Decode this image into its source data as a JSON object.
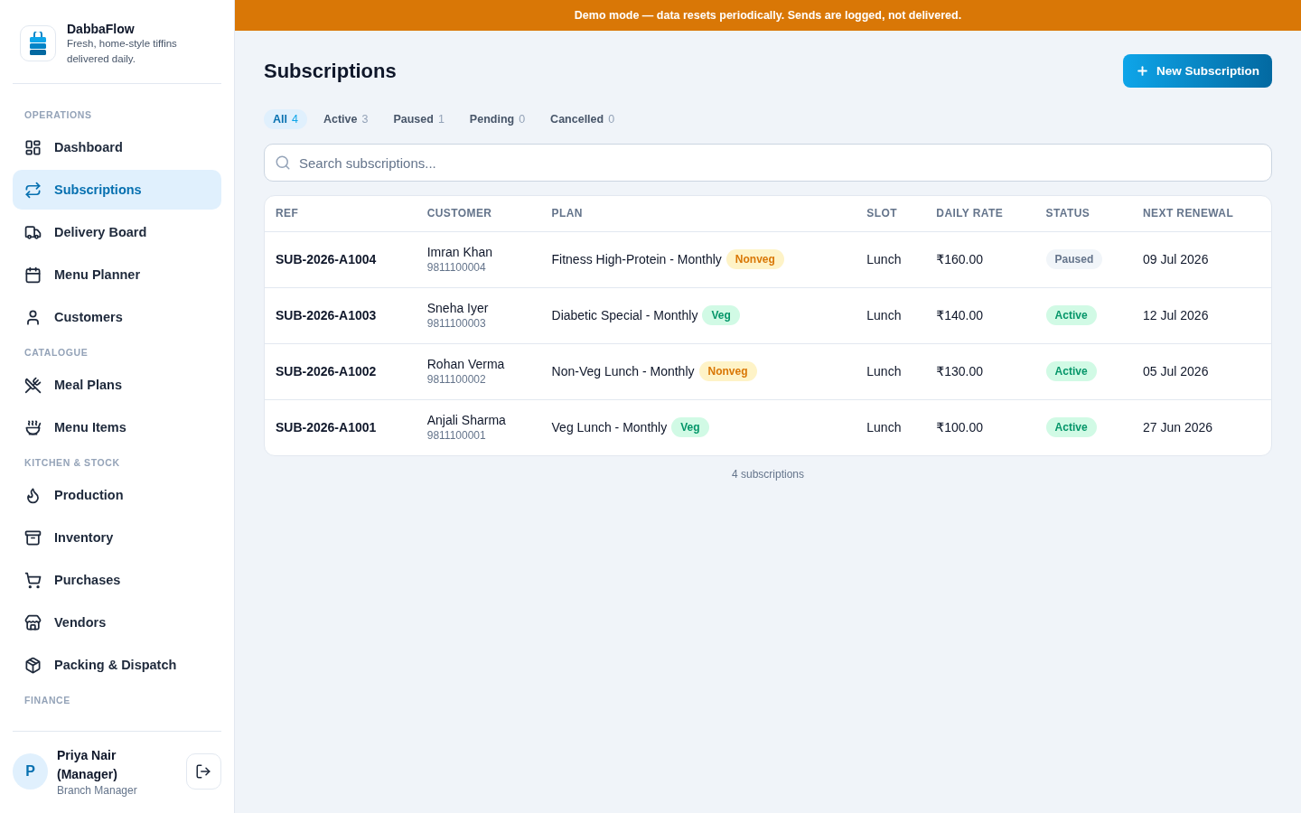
{
  "banner": "Demo mode — data resets periodically. Sends are logged, not delivered.",
  "brand": {
    "name": "DabbaFlow",
    "tagline": "Fresh, home-style tiffins delivered daily."
  },
  "sidebar": {
    "sections": [
      {
        "title": "OPERATIONS",
        "items": [
          {
            "label": "Dashboard",
            "selected": false
          },
          {
            "label": "Subscriptions",
            "selected": true
          },
          {
            "label": "Delivery Board",
            "selected": false
          },
          {
            "label": "Menu Planner",
            "selected": false
          },
          {
            "label": "Customers",
            "selected": false
          }
        ]
      },
      {
        "title": "CATALOGUE",
        "items": [
          {
            "label": "Meal Plans",
            "selected": false
          },
          {
            "label": "Menu Items",
            "selected": false
          }
        ]
      },
      {
        "title": "KITCHEN & STOCK",
        "items": [
          {
            "label": "Production",
            "selected": false
          },
          {
            "label": "Inventory",
            "selected": false
          },
          {
            "label": "Purchases",
            "selected": false
          },
          {
            "label": "Vendors",
            "selected": false
          },
          {
            "label": "Packing & Dispatch",
            "selected": false
          }
        ]
      },
      {
        "title": "FINANCE"
      }
    ]
  },
  "user": {
    "initial": "P",
    "name": "Priya Nair (Manager)",
    "role": "Branch Manager"
  },
  "page": {
    "title": "Subscriptions",
    "new_button": "New Subscription"
  },
  "tabs": [
    {
      "label": "All",
      "count": "4",
      "selected": true
    },
    {
      "label": "Active",
      "count": "3",
      "selected": false
    },
    {
      "label": "Paused",
      "count": "1",
      "selected": false
    },
    {
      "label": "Pending",
      "count": "0",
      "selected": false
    },
    {
      "label": "Cancelled",
      "count": "0",
      "selected": false
    }
  ],
  "search": {
    "placeholder": "Search subscriptions..."
  },
  "table": {
    "columns": [
      "REF",
      "CUSTOMER",
      "PLAN",
      "SLOT",
      "DAILY RATE",
      "STATUS",
      "NEXT RENEWAL"
    ],
    "rows": [
      {
        "ref": "SUB-2026-A1004",
        "customer": {
          "name": "Imran Khan",
          "phone": "9811100004"
        },
        "plan": {
          "name": "Fitness High-Protein - Monthly",
          "tag": "Nonveg",
          "kind": "nonveg"
        },
        "slot": "Lunch",
        "daily_rate": "₹160.00",
        "status": {
          "label": "Paused",
          "kind": "paused"
        },
        "next_renewal": "09 Jul 2026"
      },
      {
        "ref": "SUB-2026-A1003",
        "customer": {
          "name": "Sneha Iyer",
          "phone": "9811100003"
        },
        "plan": {
          "name": "Diabetic Special - Monthly",
          "tag": "Veg",
          "kind": "veg"
        },
        "slot": "Lunch",
        "daily_rate": "₹140.00",
        "status": {
          "label": "Active",
          "kind": "active"
        },
        "next_renewal": "12 Jul 2026"
      },
      {
        "ref": "SUB-2026-A1002",
        "customer": {
          "name": "Rohan Verma",
          "phone": "9811100002"
        },
        "plan": {
          "name": "Non-Veg Lunch - Monthly",
          "tag": "Nonveg",
          "kind": "nonveg"
        },
        "slot": "Lunch",
        "daily_rate": "₹130.00",
        "status": {
          "label": "Active",
          "kind": "active"
        },
        "next_renewal": "05 Jul 2026"
      },
      {
        "ref": "SUB-2026-A1001",
        "customer": {
          "name": "Anjali Sharma",
          "phone": "9811100001"
        },
        "plan": {
          "name": "Veg Lunch - Monthly",
          "tag": "Veg",
          "kind": "veg"
        },
        "slot": "Lunch",
        "daily_rate": "₹100.00",
        "status": {
          "label": "Active",
          "kind": "active"
        },
        "next_renewal": "27 Jun 2026"
      }
    ]
  },
  "footer": "4 subscriptions"
}
